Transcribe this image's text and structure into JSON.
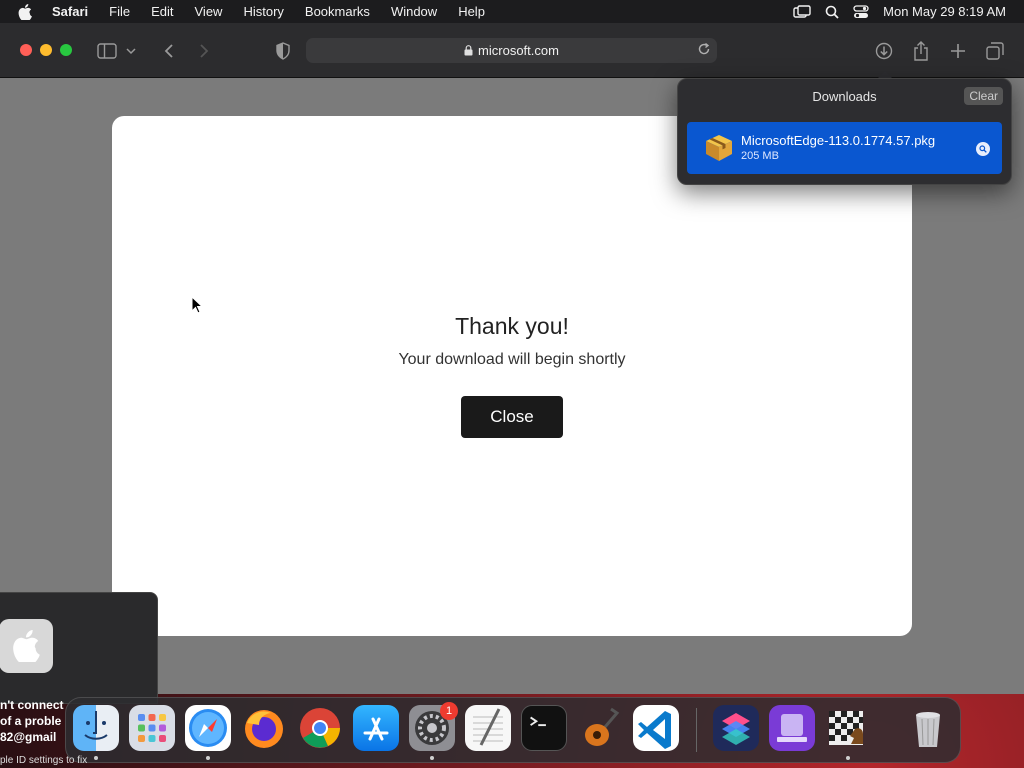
{
  "menubar": {
    "app": "Safari",
    "items": [
      "File",
      "Edit",
      "View",
      "History",
      "Bookmarks",
      "Window",
      "Help"
    ],
    "clock": "Mon May 29  8:19 AM"
  },
  "toolbar": {
    "url": "microsoft.com"
  },
  "dialog": {
    "title": "Thank you!",
    "subtitle": "Your download will begin shortly",
    "close_label": "Close"
  },
  "downloads": {
    "title": "Downloads",
    "clear_label": "Clear",
    "item": {
      "filename": "MicrosoftEdge-113.0.1774.57.pkg",
      "size": "205 MB"
    }
  },
  "notification": {
    "line1": "n't connect",
    "line2": "of a proble",
    "line3": "82@gmail",
    "line4": "ple ID settings to fix"
  },
  "dock": {
    "apps": [
      "Finder",
      "Launchpad",
      "Safari",
      "Firefox",
      "Chrome",
      "App Store",
      "System Preferences",
      "TextEdit",
      "Terminal",
      "GarageBand",
      "Visual Studio Code",
      "Shortcuts",
      "Simulator",
      "Chess",
      "Trash"
    ],
    "system_prefs_badge": "1"
  },
  "colors": {
    "accent_blue": "#0a57d0",
    "dialog_button": "#1a1a1a",
    "badge_red": "#ee3b30"
  }
}
